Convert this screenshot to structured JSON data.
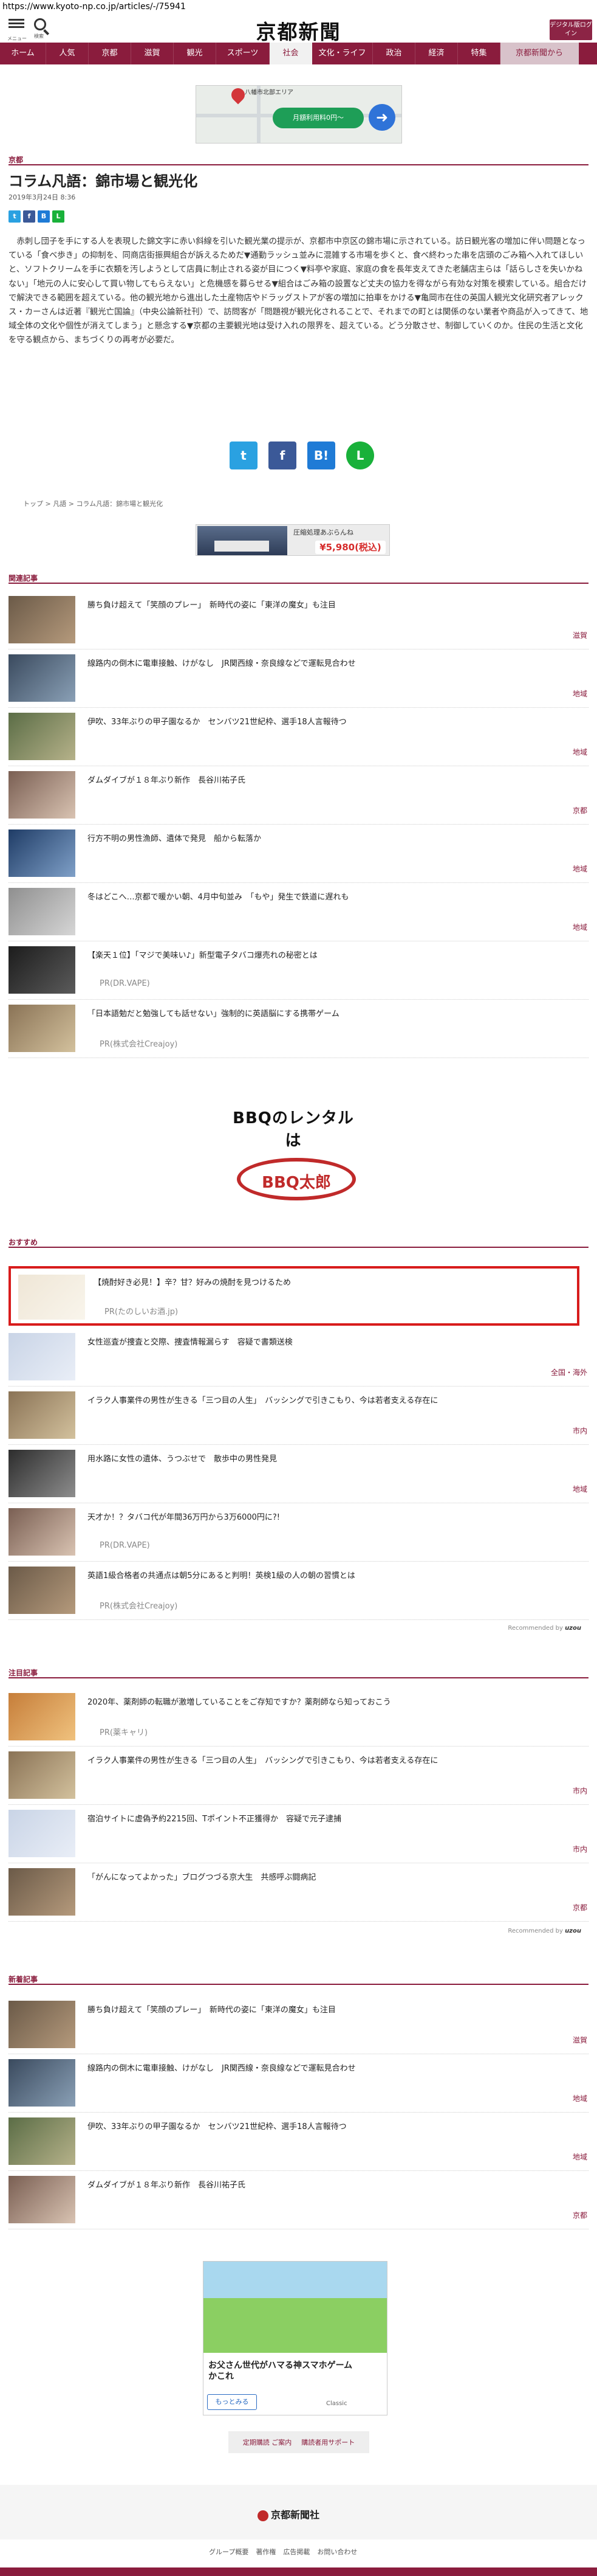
{
  "url": "https://www.kyoto-np.co.jp/articles/-/75941",
  "header": {
    "menu_label": "メニュー",
    "search_label": "検索",
    "logo": "京都新聞",
    "digital_button": "デジタル版ログイン"
  },
  "nav": {
    "items": [
      "ホーム",
      "人気",
      "京都",
      "滋賀",
      "観光",
      "スポーツ",
      "社会",
      "文化・ライフ",
      "政治",
      "経済",
      "特集",
      "京都新聞から"
    ],
    "active": "社会"
  },
  "map_ad": {
    "place": "八幡市北部エリア",
    "pill": "月額利用料0円〜",
    "direction_icon": "directions-icon"
  },
  "article": {
    "section": "京都",
    "title": "コラム凡語：錦市場と観光化",
    "date": "2019年3月24日 8:36",
    "body": "赤刺し団子を手にする人を表現した錦文字に赤い斜線を引いた観光業の提示が、京都市中京区の錦市場に示されている。訪日観光客の増加に伴い問題となっている「食べ歩き」の抑制を、同商店街振興組合が訴えるためだ▼通勤ラッシュ並みに混雑する市場を歩くと、食べ終わった串を店頭のごみ箱へ入れてほしいと、ソフトクリームを手に衣類を汚しようとして店員に制止される姿が目につく▼料亭や家庭、家庭の食を長年支えてきた老舗店主らは「話らしさを失いかねない」「地元の人に安心して買い物してもらえない」と危機感を募らせる▼組合はごみ箱の設置など丈夫の協力を得ながら有効な対策を模索している。組合だけで解決できる範囲を超えている。他の観光地から進出した土産物店やドラッグストアが客の増加に拍車をかける▼亀岡市在住の英国人観光文化研究者アレックス・カーさんは近著『観光亡国論』（中央公論新社刊）で、訪問客が「問題視が観光化されることで、それまでの町とは関係のない業者や商品が入ってきて、地域全体の文化や個性が消えてしまう」と懸念する▼京都の主要観光地は受け入れの限界を、超えている。どう分散させ、制御していくのか。住民の生活と文化を守る観点から、まちづくりの再考が必要だ。"
  },
  "breadcrumb": [
    "トップ",
    "凡語",
    "コラム凡語：錦市場と観光化"
  ],
  "bed_ad": {
    "headline": "圧縮処理あぶらんね",
    "price": "¥5,980(税込)"
  },
  "related": {
    "heading": "関連記事",
    "items": [
      {
        "title": "勝ち負け超えて「笑顔のプレー」　新時代の姿に「東洋の魔女」も注目",
        "category": "滋賀"
      },
      {
        "title": "線路内の倒木に電車接触、けがなし　JR関西線・奈良線などで運転見合わせ",
        "category": "地域"
      },
      {
        "title": "伊吹、33年ぶりの甲子園なるか　センバツ21世紀枠、選手18人言報待つ",
        "category": "地域"
      },
      {
        "title": "ダムダイブが１８年ぶり新作　長谷川祐子氏",
        "category": "京都"
      },
      {
        "title": "行方不明の男性漁師、遺体で発見　船から転落か",
        "category": "地域"
      },
      {
        "title": "冬はどこへ…京都で暖かい朝、4月中旬並み　「もや」発生で鉄道に遅れも",
        "category": "地域"
      }
    ],
    "pr_items": [
      {
        "title": "【楽天１位】「マジで美味い♪」新型電子タバコ爆売れの秘密とは",
        "sponsor": "PR(DR.VAPE)"
      },
      {
        "title": "「日本語勉だと勉強しても話せない」強制的に英語脳にする携帯ゲーム",
        "sponsor": "PR(株式会社Creajoy)"
      }
    ]
  },
  "bbq_ad": {
    "headline": "BBQのレンタルは",
    "brand": "BBQ太郎"
  },
  "recommend": {
    "heading": "おすすめ",
    "highlighted": {
      "title": "【焼酎好き必見！】辛？甘？好みの焼酎を見つけるため",
      "sponsor": "PR(たのしいお酒.jp)"
    },
    "items": [
      {
        "title": "女性巡査が捜査と交際、捜査情報漏らす　容疑で書類送検",
        "category": "全国・海外"
      },
      {
        "title": "イラク人事業件の男性が生きる「三つ目の人生」　バッシングで引きこもり、今は若者支える存在に",
        "category": "市内"
      },
      {
        "title": "用水路に女性の遺体、うつぶせで　散歩中の男性発見",
        "category": "地域"
      }
    ],
    "pr_items": [
      {
        "title": "天才か！？タバコ代が年間36万円から3万6000円に?!",
        "sponsor": "PR(DR.VAPE)"
      },
      {
        "title": "英語1級合格者の共通点は朝5分にあると判明！英検1級の人の朝の習慣とは",
        "sponsor": "PR(株式会社Creajoy)"
      }
    ],
    "powered_prefix": "Recommended by",
    "powered_brand": "uzou"
  },
  "featured": {
    "heading": "注目記事",
    "pr_item": {
      "title": "2020年、薬剤師の転職が激増していることをご存知ですか？薬剤師なら知っておこう",
      "sponsor": "PR(薬キャリ)"
    },
    "items": [
      {
        "title": "イラク人事業件の男性が生きる「三つ目の人生」　バッシングで引きこもり、今は若者支える存在に",
        "category": "市内"
      },
      {
        "title": "宿泊サイトに虚偽予約2215回、Tポイント不正獲得か　容疑で元子逮捕",
        "category": "市内"
      },
      {
        "title": "「がんになってよかった」ブログつづる京大生　共感呼ぶ闘病記",
        "category": "京都"
      }
    ],
    "powered_prefix": "Recommended by",
    "powered_brand": "uzou"
  },
  "newest": {
    "heading": "新着記事",
    "items": [
      {
        "title": "勝ち負け超えて「笑顔のプレー」　新時代の姿に「東洋の魔女」も注目",
        "category": "滋賀"
      },
      {
        "title": "線路内の倒木に電車接触、けがなし　JR関西線・奈良線などで運転見合わせ",
        "category": "地域"
      },
      {
        "title": "伊吹、33年ぶりの甲子園なるか　センバツ21世紀枠、選手18人言報待つ",
        "category": "地域"
      },
      {
        "title": "ダムダイブが１８年ぶり新作　長谷川祐子氏",
        "category": "京都"
      }
    ]
  },
  "game_ad": {
    "title_line1": "お父さん世代がハマる神スマホゲーム",
    "title_line2": "かこれ",
    "button": "もっとみる",
    "advertiser": "Classic"
  },
  "footer": {
    "links": [
      "定期購読 ご案内",
      "購読者用サポート"
    ],
    "logo": "京都新聞社",
    "nav": [
      "グループ概要",
      "著作権",
      "広告掲載",
      "お問い合わせ"
    ]
  }
}
